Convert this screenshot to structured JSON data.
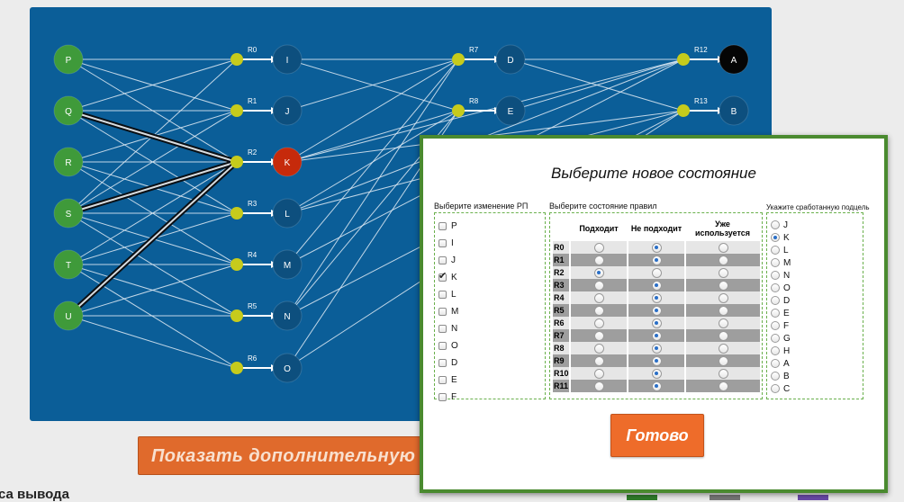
{
  "graph": {
    "input_nodes": [
      "P",
      "Q",
      "R",
      "S",
      "T",
      "U"
    ],
    "rule_labels": [
      "R0",
      "R1",
      "R2",
      "R3",
      "R4",
      "R5",
      "R6",
      "R7",
      "R8",
      "R12",
      "R13"
    ],
    "mid_nodes": [
      "I",
      "J",
      "K",
      "L",
      "M",
      "N",
      "O"
    ],
    "right_nodes": [
      "D",
      "E"
    ],
    "final_nodes": [
      "A",
      "B"
    ],
    "active_node": "K"
  },
  "colors": {
    "panel": "#0b5e98",
    "node_blue": "#0d4f7e",
    "node_green": "#3f9a3a",
    "node_red": "#c62a0b",
    "rule_dot": "#c6cb1c",
    "accent_orange": "#ee6c2a",
    "modal_border": "#4a8a2f"
  },
  "more_button": {
    "label": "Показать дополнительную"
  },
  "bottom_text": "са вывода",
  "modal": {
    "title": "Выберите новое состояние",
    "left_title": "Выберите изменение РП",
    "mid_title": "Выберите состояние правил",
    "right_title": "Укажите сработанную подцель",
    "checkboxes": [
      {
        "label": "P",
        "checked": false
      },
      {
        "label": "I",
        "checked": false
      },
      {
        "label": "J",
        "checked": false
      },
      {
        "label": "K",
        "checked": true
      },
      {
        "label": "L",
        "checked": false
      },
      {
        "label": "M",
        "checked": false
      },
      {
        "label": "N",
        "checked": false
      },
      {
        "label": "O",
        "checked": false
      },
      {
        "label": "D",
        "checked": false
      },
      {
        "label": "E",
        "checked": false
      },
      {
        "label": "F",
        "checked": false
      }
    ],
    "rules_headers": [
      "Подходит",
      "Не подходит",
      "Уже используется"
    ],
    "rules": [
      {
        "name": "R0",
        "state": 1
      },
      {
        "name": "R1",
        "state": 1
      },
      {
        "name": "R2",
        "state": 0
      },
      {
        "name": "R3",
        "state": 1
      },
      {
        "name": "R4",
        "state": 1
      },
      {
        "name": "R5",
        "state": 1
      },
      {
        "name": "R6",
        "state": 1
      },
      {
        "name": "R7",
        "state": 1
      },
      {
        "name": "R8",
        "state": 1
      },
      {
        "name": "R9",
        "state": 1
      },
      {
        "name": "R10",
        "state": 1
      },
      {
        "name": "R11",
        "state": 1
      }
    ],
    "subgoals": [
      {
        "label": "J",
        "selected": false
      },
      {
        "label": "K",
        "selected": true
      },
      {
        "label": "L",
        "selected": false
      },
      {
        "label": "M",
        "selected": false
      },
      {
        "label": "N",
        "selected": false
      },
      {
        "label": "O",
        "selected": false
      },
      {
        "label": "D",
        "selected": false
      },
      {
        "label": "E",
        "selected": false
      },
      {
        "label": "F",
        "selected": false
      },
      {
        "label": "G",
        "selected": false
      },
      {
        "label": "H",
        "selected": false
      },
      {
        "label": "A",
        "selected": false
      },
      {
        "label": "B",
        "selected": false
      },
      {
        "label": "C",
        "selected": false
      }
    ],
    "done_label": "Готово"
  }
}
